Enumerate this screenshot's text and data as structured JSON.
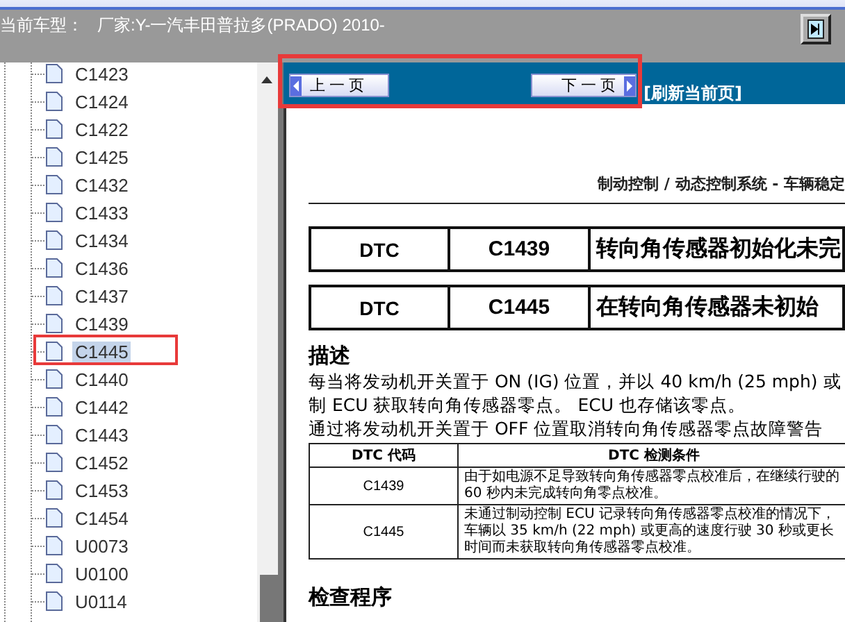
{
  "toolbar": {
    "label": "当前车型：",
    "value": "厂家:Y-一汽丰田普拉多(PRADO) 2010-"
  },
  "tree": {
    "items": [
      {
        "label": "C1423",
        "selected": false
      },
      {
        "label": "C1424",
        "selected": false
      },
      {
        "label": "C1422",
        "selected": false
      },
      {
        "label": "C1425",
        "selected": false
      },
      {
        "label": "C1432",
        "selected": false
      },
      {
        "label": "C1433",
        "selected": false
      },
      {
        "label": "C1434",
        "selected": false
      },
      {
        "label": "C1436",
        "selected": false
      },
      {
        "label": "C1437",
        "selected": false
      },
      {
        "label": "C1439",
        "selected": false
      },
      {
        "label": "C1445",
        "selected": true
      },
      {
        "label": "C1440",
        "selected": false
      },
      {
        "label": "C1442",
        "selected": false
      },
      {
        "label": "C1443",
        "selected": false
      },
      {
        "label": "C1452",
        "selected": false
      },
      {
        "label": "C1453",
        "selected": false
      },
      {
        "label": "C1454",
        "selected": false
      },
      {
        "label": "U0073",
        "selected": false
      },
      {
        "label": "U0100",
        "selected": false
      },
      {
        "label": "U0114",
        "selected": false
      }
    ]
  },
  "nav": {
    "prev": "上 一 页",
    "next": "下 一 页",
    "refresh": "[刷新当前页]"
  },
  "document": {
    "header": "制动控制 / 动态控制系统 - 车辆稳定",
    "dtc_rows": [
      {
        "label": "DTC",
        "code": "C1439",
        "title": "转向角传感器初始化未完"
      },
      {
        "label": "DTC",
        "code": "C1445",
        "title": "在转向角传感器未初始"
      }
    ],
    "description_heading": "描述",
    "description": [
      "每当将发动机开关置于 ON (IG) 位置，并以 40 km/h (25 mph) 或",
      "制 ECU 获取转向角传感器零点。 ECU 也存储该零点。",
      "通过将发动机开关置于 OFF 位置取消转向角传感器零点故障警告"
    ],
    "table": {
      "columns": [
        "DTC 代码",
        "DTC 检测条件"
      ],
      "rows": [
        {
          "code": "C1439",
          "condition": "由于如电源不足导致转向角传感器零点校准后，在继续行驶的 60 秒内未完成转向角零点校准。"
        },
        {
          "code": "C1445",
          "condition": "未通过制动控制 ECU 记录转向角传感器零点校准的情况下，车辆以 35 km/h (22 mph) 或更高的速度行驶 30 秒或更长时间而未获取转向角传感器零点校准。"
        }
      ]
    },
    "procedure_heading": "检查程序"
  }
}
